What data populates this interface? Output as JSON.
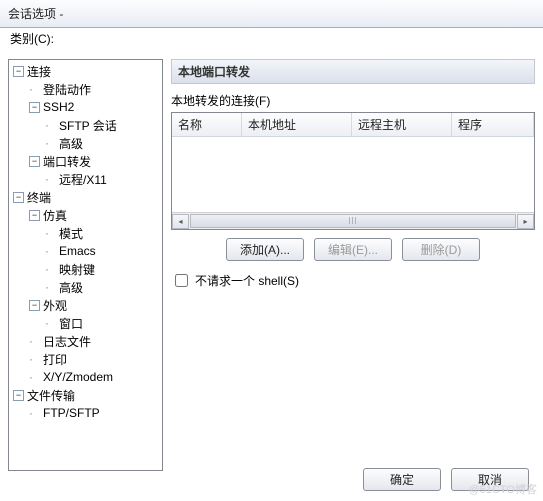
{
  "window": {
    "title": "会话选项 -"
  },
  "category_label": "类别(C):",
  "tree": [
    {
      "label": "连接",
      "exp": true,
      "children": [
        {
          "label": "登陆动作"
        },
        {
          "label": "SSH2",
          "exp": true,
          "children": [
            {
              "label": "SFTP 会话"
            },
            {
              "label": "高级"
            }
          ]
        },
        {
          "label": "端口转发",
          "exp": true,
          "children": [
            {
              "label": "远程/X11"
            }
          ]
        }
      ]
    },
    {
      "label": "终端",
      "exp": true,
      "children": [
        {
          "label": "仿真",
          "exp": true,
          "children": [
            {
              "label": "模式"
            },
            {
              "label": "Emacs"
            },
            {
              "label": "映射键"
            },
            {
              "label": "高级"
            }
          ]
        },
        {
          "label": "外观",
          "exp": true,
          "children": [
            {
              "label": "窗口"
            }
          ]
        },
        {
          "label": "日志文件"
        },
        {
          "label": "打印"
        },
        {
          "label": "X/Y/Zmodem"
        }
      ]
    },
    {
      "label": "文件传输",
      "exp": true,
      "children": [
        {
          "label": "FTP/SFTP"
        }
      ]
    }
  ],
  "panel": {
    "heading": "本地端口转发",
    "list_label": "本地转发的连接(F)",
    "columns": [
      "名称",
      "本机地址",
      "远程主机",
      "程序"
    ],
    "buttons": {
      "add": "添加(A)...",
      "edit": "编辑(E)...",
      "del": "删除(D)"
    },
    "checkbox": "不请求一个 shell(S)"
  },
  "footer": {
    "ok": "确定",
    "cancel": "取消"
  },
  "watermark": "@51CTO博客"
}
